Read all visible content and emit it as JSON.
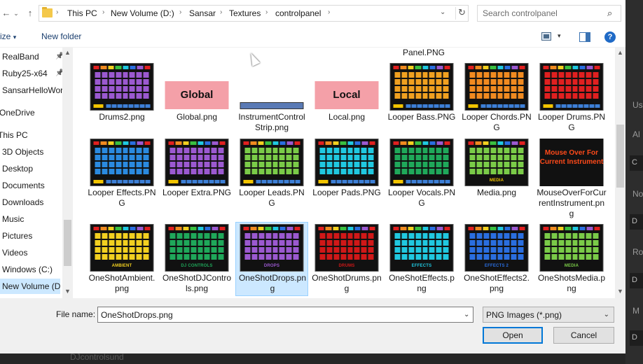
{
  "address_bar": {
    "breadcrumbs": [
      "This PC",
      "New Volume (D:)",
      "Sansar",
      "Textures",
      "controlpanel"
    ]
  },
  "search": {
    "placeholder": "Search controlpanel"
  },
  "toolbar": {
    "organize_label": "ize",
    "new_folder_label": "New folder"
  },
  "nav_pane": {
    "items": [
      {
        "label": "RealBand",
        "pinned": true
      },
      {
        "label": "Ruby25-x64",
        "pinned": true
      },
      {
        "label": "SansarHelloWorl",
        "pinned": false
      },
      {
        "label": "OneDrive",
        "pinned": false
      },
      {
        "label": "This PC",
        "pinned": false
      },
      {
        "label": "3D Objects",
        "pinned": false
      },
      {
        "label": "Desktop",
        "pinned": false
      },
      {
        "label": "Documents",
        "pinned": false
      },
      {
        "label": "Downloads",
        "pinned": false
      },
      {
        "label": "Music",
        "pinned": false
      },
      {
        "label": "Pictures",
        "pinned": false
      },
      {
        "label": "Videos",
        "pinned": false
      },
      {
        "label": "Windows (C:)",
        "pinned": false
      },
      {
        "label": "New Volume (D:",
        "pinned": false,
        "selected": true
      }
    ]
  },
  "files": {
    "partial_label": "Panel.PNG",
    "items": [
      {
        "name": "Drums2.png",
        "thumb": "panel",
        "color": "#9b59d0",
        "caption": ""
      },
      {
        "name": "Global.png",
        "thumb": "label",
        "text": "Global"
      },
      {
        "name": "InstrumentControlStrip.png",
        "thumb": "strip"
      },
      {
        "name": "Local.png",
        "thumb": "label",
        "text": "Local"
      },
      {
        "name": "Looper Bass.PNG",
        "thumb": "panel",
        "color": "#f0a020",
        "caption": ""
      },
      {
        "name": "Looper Chords.PNG",
        "thumb": "panel",
        "color": "#f08a20",
        "caption": ""
      },
      {
        "name": "Looper Drums.PNG",
        "thumb": "panel",
        "color": "#e02020",
        "caption": ""
      },
      {
        "name": "Looper Effects.PNG",
        "thumb": "panel",
        "color": "#2a8ae0",
        "caption": ""
      },
      {
        "name": "Looper Extra.PNG",
        "thumb": "panel",
        "color": "#9b59d0",
        "caption": ""
      },
      {
        "name": "Looper Leads.PNG",
        "thumb": "panel",
        "color": "#7acb48",
        "caption": ""
      },
      {
        "name": "Looper Pads.PNG",
        "thumb": "panel",
        "color": "#20c8e0",
        "caption": ""
      },
      {
        "name": "Looper Vocals.PNG",
        "thumb": "panel",
        "color": "#1fa85a",
        "caption": ""
      },
      {
        "name": "Media.png",
        "thumb": "panel",
        "color": "#7acb48",
        "caption": "MEDIA",
        "caption_color": "#f2c400"
      },
      {
        "name": "MouseOverForCurrentInstrument.png",
        "thumb": "mouseover",
        "text": "Mouse Over For Current Instrument"
      },
      {
        "name": "OneShotAmbient.png",
        "thumb": "panel",
        "color": "#f2d020",
        "caption": "AMBIENT",
        "caption_color": "#f2d020"
      },
      {
        "name": "OneShotDJControls.png",
        "thumb": "panel",
        "color": "#1fa85a",
        "caption": "DJ CONTROLS",
        "caption_color": "#1fa85a"
      },
      {
        "name": "OneShotDrops.png",
        "thumb": "panel",
        "color": "#9b59d0",
        "caption": "DROPS",
        "caption_color": "#9b59d0",
        "selected": true
      },
      {
        "name": "OneShotDrums.png",
        "thumb": "panel",
        "color": "#d01818",
        "caption": "DRUMS",
        "caption_color": "#d01818"
      },
      {
        "name": "OneShotEffects.png",
        "thumb": "panel",
        "color": "#20c8e0",
        "caption": "EFFECTS",
        "caption_color": "#20c8e0"
      },
      {
        "name": "OneShotEffects2.png",
        "thumb": "panel",
        "color": "#2a6ee0",
        "caption": "EFFECTS 2",
        "caption_color": "#2a6ee0"
      },
      {
        "name": "OneShotsMedia.png",
        "thumb": "panel",
        "color": "#7acb48",
        "caption": "MEDIA",
        "caption_color": "#7acb48"
      }
    ]
  },
  "bottom": {
    "filename_label": "File name:",
    "filename_value": "OneShotDrops.png",
    "filetype_value": "PNG Images (*.png)",
    "open_label": "Open",
    "cancel_label": "Cancel"
  },
  "background": {
    "right_labels": [
      "Use",
      "Al",
      "C",
      "No",
      "D",
      "Ro",
      "D",
      "M",
      "D"
    ],
    "bottom_text": "DJcontrolsund"
  },
  "colors": {
    "topbar": [
      "#e02020",
      "#f08a20",
      "#f2d020",
      "#3ac040",
      "#20c8e0",
      "#2a6ee0",
      "#9b59d0",
      "#e02020"
    ],
    "selection": "#cce8ff",
    "accent": "#0078d7"
  }
}
